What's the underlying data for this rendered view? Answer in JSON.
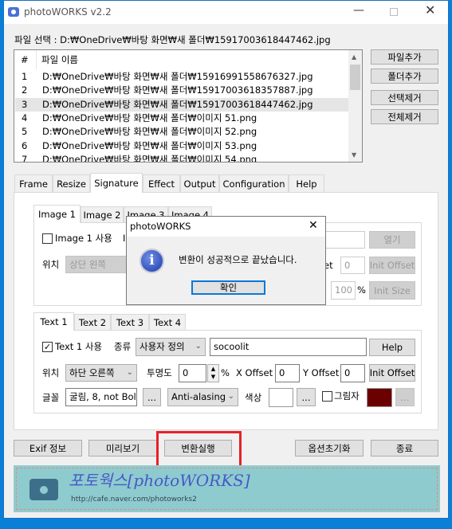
{
  "window": {
    "title": "photoWORKS v2.2",
    "icon": "camera-icon"
  },
  "file_label": "파일 선택 : D:₩OneDrive₩바탕 화면₩새 폴더₩15917003618447462.jpg",
  "file_list": {
    "columns": [
      "#",
      "파일 이름"
    ],
    "rows": [
      {
        "n": "1",
        "name": "D:₩OneDrive₩바탕 화면₩새 폴더₩15916991558676327.jpg"
      },
      {
        "n": "2",
        "name": "D:₩OneDrive₩바탕 화면₩새 폴더₩15917003618357887.jpg"
      },
      {
        "n": "3",
        "name": "D:₩OneDrive₩바탕 화면₩새 폴더₩15917003618447462.jpg",
        "selected": true
      },
      {
        "n": "4",
        "name": "D:₩OneDrive₩바탕 화면₩새 폴더₩이미지 51.png"
      },
      {
        "n": "5",
        "name": "D:₩OneDrive₩바탕 화면₩새 폴더₩이미지 52.png"
      },
      {
        "n": "6",
        "name": "D:₩OneDrive₩바탕 화면₩새 폴더₩이미지 53.png"
      },
      {
        "n": "7",
        "name": "D:₩OneDrive₩바탕 화면₩새 폴더₩이미지 54.png"
      }
    ]
  },
  "side_buttons": [
    "파일추가",
    "폴더추가",
    "선택제거",
    "전체제거"
  ],
  "tabs": [
    "Frame",
    "Resize",
    "Signature",
    "Effect",
    "Output",
    "Configuration",
    "Help"
  ],
  "active_tab": "Signature",
  "image_tabs": [
    "Image 1",
    "Image 2",
    "Image 3",
    "Image 4"
  ],
  "image": {
    "use_label": "Image 1 사용",
    "use_checked": false,
    "partial": "I",
    "pos_label": "위치",
    "pos_value": "상단 왼쪽",
    "open_btn": "열기",
    "offset_partial": "set",
    "offset_value": "0",
    "init_offset": "Init Offset",
    "size_value": "100",
    "pct": "%",
    "init_size": "Init Size"
  },
  "text_tabs": [
    "Text 1",
    "Text 2",
    "Text 3",
    "Text 4"
  ],
  "text": {
    "use_label": "Text 1 사용",
    "use_checked": true,
    "type_label": "종류",
    "type_value": "사용자 정의",
    "text_value": "socoolit",
    "help": "Help",
    "pos_label": "위치",
    "pos_value": "하단 오른쪽",
    "opacity_label": "투명도",
    "opacity_value": "0",
    "pct": "%",
    "xoff_label": "X Offset",
    "xoff_value": "0",
    "yoff_label": "Y Offset",
    "yoff_value": "0",
    "init_offset": "Init Offset",
    "font_label": "글꼴",
    "font_value": "굴림, 8, not Bol",
    "dots": "...",
    "aa_value": "Anti-alasing",
    "color_label": "색상",
    "color_value": "#ffffff",
    "shadow_label": "그림자",
    "shadow_checked": false,
    "shadow_color": "#6b0000"
  },
  "bottom_buttons": [
    "Exif 정보",
    "미리보기",
    "변환실행",
    "옵션초기화",
    "종료"
  ],
  "highlight_color": "#e8202a",
  "banner": {
    "title": "포토웍스[photoWORKS]",
    "url": "http://cafe.naver.com/photoworks2"
  },
  "dialog": {
    "title": "photoWORKS",
    "icon": "info-icon",
    "message": "변환이 성공적으로 끝났습니다.",
    "ok": "확인"
  }
}
